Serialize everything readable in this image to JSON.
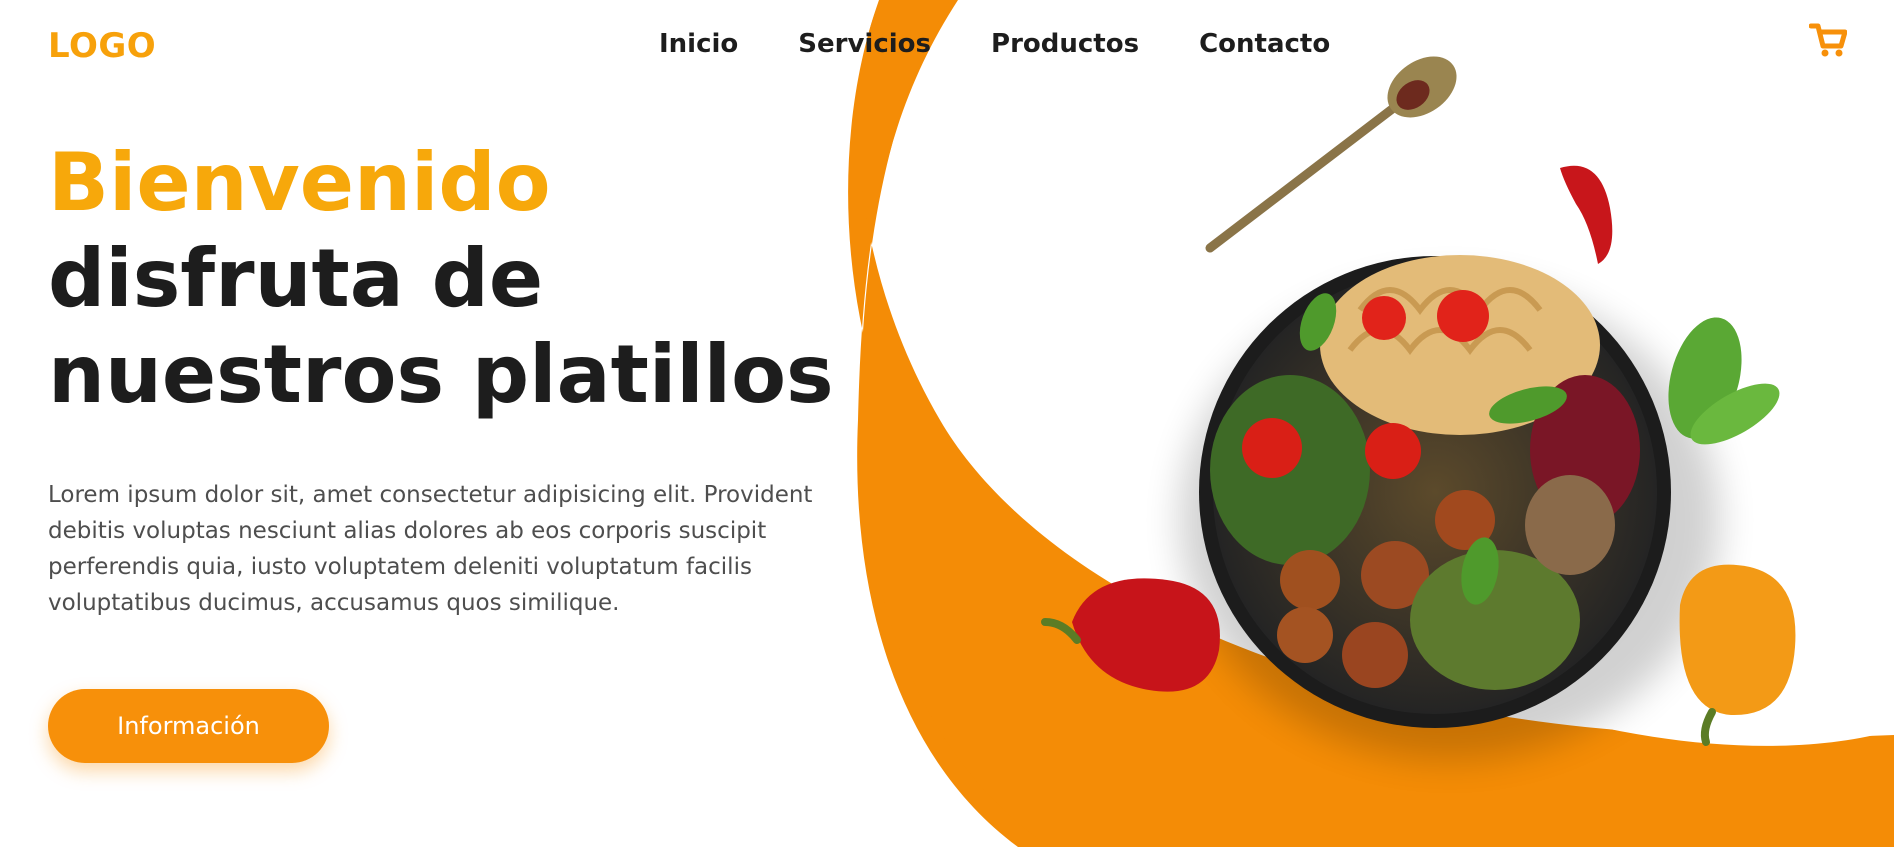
{
  "brand": {
    "logo": "LOGO"
  },
  "nav": {
    "items": [
      "Inicio",
      "Servicios",
      "Productos",
      "Contacto"
    ]
  },
  "hero": {
    "title_accent": "Bienvenido",
    "title_line_2": "disfruta de",
    "title_line_3": "nuestros platillos",
    "text": "Lorem ipsum dolor sit, amet consectetur adipisicing elit. Provident debitis voluptas nesciunt alias dolores ab eos corporis suscipit perferendis quia, iusto voluptatem deleniti voluptatum facilis voluptatibus ducimus, accusamus quos similique.",
    "button_label": "Información"
  },
  "icons": {
    "cart": "cart-icon"
  },
  "colors": {
    "accent": "#f7900a",
    "title_accent": "#f7a80b",
    "text_dark": "#1d1d1d",
    "text_body": "#4e4e4e"
  }
}
